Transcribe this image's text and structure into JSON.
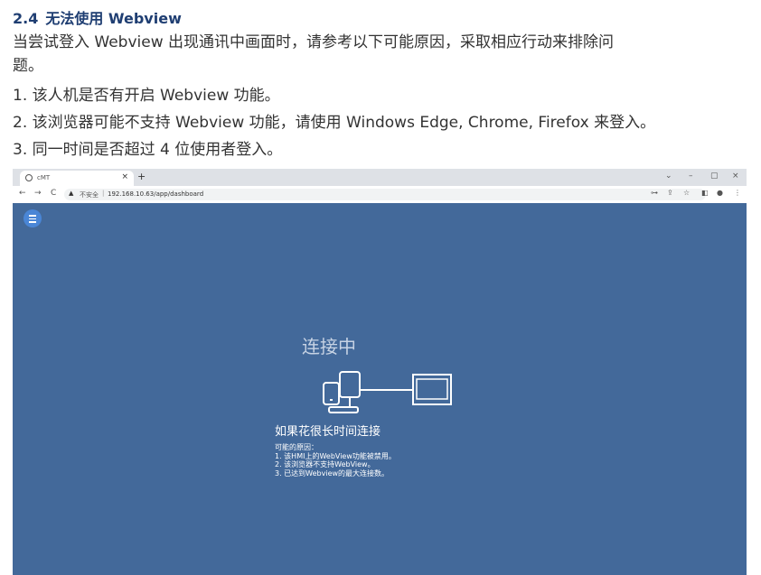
{
  "doc": {
    "section_number": "2.4",
    "section_title": "无法使用 Webview",
    "intro_line1": "当尝试登入 Webview 出现通讯中画面时，请参考以下可能原因，采取相应行动来排除问",
    "intro_line2": "题。",
    "items": [
      "1.  该人机是否有开启 Webview 功能。",
      "2.  该浏览器可能不支持 Webview 功能，请使用 Windows Edge, Chrome, Firefox 来登入。",
      "3.  同一时间是否超过 4 位使用者登入。"
    ]
  },
  "browser": {
    "tab_title": "cMT",
    "tab_close": "×",
    "new_tab": "+",
    "window_controls": [
      "⌄",
      "–",
      "▢",
      "×"
    ],
    "nav": {
      "back": "←",
      "forward": "→",
      "reload": "C"
    },
    "security_warning_icon": "warning-triangle-icon",
    "security_label": "不安全",
    "url_separator": "|",
    "url": "192.168.10.63/app/dashboard",
    "toolbar_icons": [
      "key-icon",
      "share-icon",
      "star-icon",
      "sidepanel-icon",
      "profile-icon",
      "more-icon"
    ]
  },
  "app": {
    "menu_icon": "hamburger-menu-icon",
    "status_text": "连接中",
    "long_wait_title": "如果花很长时间连接",
    "reasons_title": "可能的原因：",
    "reasons": [
      "1. 该HMI上的WebView功能被禁用。",
      "2. 该浏览器不支持WebView。",
      "3. 已达到Webview的最大连接数。"
    ],
    "colors": {
      "background": "#43699a",
      "menu_button": "#4a86d6"
    }
  }
}
